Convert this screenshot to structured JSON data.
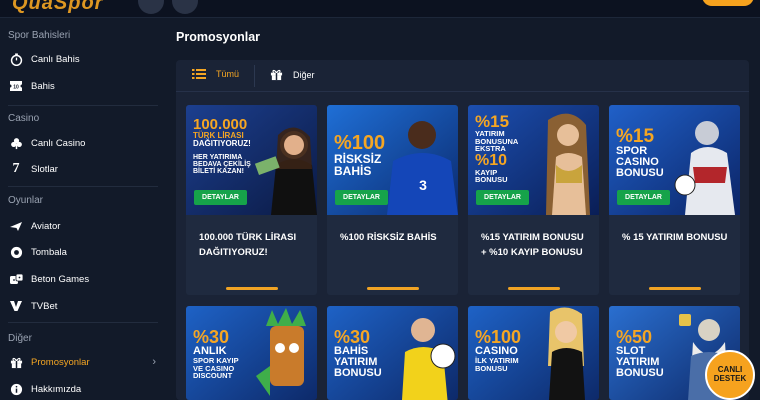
{
  "sidebar": {
    "sections": [
      {
        "title": "Spor Bahisleri",
        "items": [
          {
            "label": "Canlı Bahis",
            "icon": "stopwatch-icon"
          },
          {
            "label": "Bahis",
            "icon": "ticket-icon"
          }
        ]
      },
      {
        "title": "Casino",
        "items": [
          {
            "label": "Canlı Casino",
            "icon": "club-icon"
          },
          {
            "label": "Slotlar",
            "icon": "seven-icon"
          }
        ]
      },
      {
        "title": "Oyunlar",
        "items": [
          {
            "label": "Aviator",
            "icon": "plane-icon"
          },
          {
            "label": "Tombala",
            "icon": "ball-icon"
          },
          {
            "label": "Beton Games",
            "icon": "dice-icon"
          },
          {
            "label": "TVBet",
            "icon": "tvbet-icon"
          }
        ]
      },
      {
        "title": "Diğer",
        "items": [
          {
            "label": "Promosyonlar",
            "icon": "gift-icon",
            "active": true
          },
          {
            "label": "Hakkımızda",
            "icon": "info-icon"
          }
        ]
      }
    ]
  },
  "main": {
    "title": "Promosyonlar",
    "filters": [
      {
        "label": "Tümü",
        "icon": "list-icon",
        "active": true
      },
      {
        "label": "Diğer",
        "icon": "gift-icon"
      }
    ],
    "detail_button": "DETAYLAR",
    "cards": [
      {
        "title": "100.000 TÜRK LİRASI DAĞITIYORUZ!",
        "banner": {
          "big": "100.000",
          "lines": [
            "TÜRK LİRASI",
            "DAĞITIYORUZ!"
          ],
          "small": [
            "HER YATIRIMA",
            "BEDAVA ÇEKİLİŞ",
            "BİLETİ KAZAN!"
          ]
        }
      },
      {
        "title": "%100 RİSKSİZ BAHİS",
        "banner": {
          "big": "%100",
          "lines": [
            "RİSKSİZ",
            "BAHİS"
          ],
          "small": []
        }
      },
      {
        "title": "%15 YATIRIM BONUSU + %10 KAYIP BONUSU",
        "banner": {
          "big": "%15",
          "lines": [
            "YATIRIM",
            "BONUSUNA",
            "EKSTRA"
          ],
          "small": []
        }
      },
      {
        "title": "% 15 YATIRIM BONUSU",
        "banner": {
          "big": "%15",
          "lines": [
            "SPOR",
            "CASINO",
            "BONUSU"
          ],
          "small": []
        }
      },
      {
        "title": "",
        "banner": {
          "big": "%30",
          "lines": [
            "ANLIK"
          ],
          "small": [
            "SPOR KAYIP",
            "VE CASINO",
            "DISCOUNT"
          ]
        }
      },
      {
        "title": "",
        "banner": {
          "big": "%30",
          "lines": [
            "BAHİS",
            "YATIRIM",
            "BONUSU"
          ],
          "small": []
        }
      },
      {
        "title": "",
        "banner": {
          "big": "%100",
          "lines": [
            "CASINO"
          ],
          "small": [
            "İLK YATIRIM",
            "BONUSU"
          ]
        }
      },
      {
        "title": "",
        "banner": {
          "big": "%50",
          "lines": [
            "SLOT",
            "YATIRIM",
            "BONUSU"
          ],
          "small": []
        }
      }
    ]
  },
  "card2_extra": {
    "big2": "%10",
    "lines2": [
      "KAYIP",
      "BONUSU"
    ]
  },
  "live_support": {
    "line1": "CANLI",
    "line2": "DESTEK"
  },
  "colors": {
    "accent": "#f5a623",
    "button": "#16a34a",
    "bg": "#121a29",
    "panel": "#1a2336"
  }
}
